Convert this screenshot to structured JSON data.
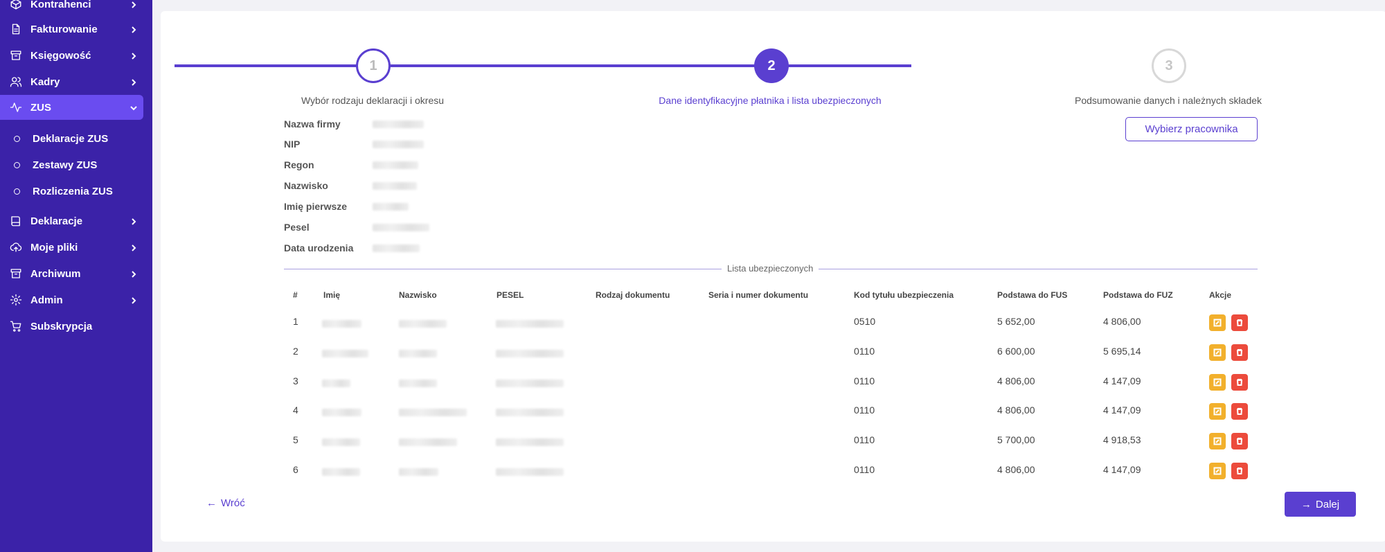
{
  "sidebar": {
    "items": [
      {
        "label": "Kontrahenci",
        "icon": "box-icon"
      },
      {
        "label": "Fakturowanie",
        "icon": "document-icon"
      },
      {
        "label": "Księgowość",
        "icon": "archive-icon"
      },
      {
        "label": "Kadry",
        "icon": "users-icon"
      },
      {
        "label": "ZUS",
        "icon": "activity-icon"
      },
      {
        "label": "Deklaracje",
        "icon": "book-icon"
      },
      {
        "label": "Moje pliki",
        "icon": "cloud-upload-icon"
      },
      {
        "label": "Archiwum",
        "icon": "archive-icon"
      },
      {
        "label": "Admin",
        "icon": "gear-icon"
      },
      {
        "label": "Subskrypcja",
        "icon": "cart-icon"
      }
    ],
    "zus_subitems": [
      "Deklaracje ZUS",
      "Zestawy ZUS",
      "Rozliczenia ZUS"
    ]
  },
  "steps": [
    {
      "number": "1",
      "label": "Wybór rodzaju deklaracji i okresu",
      "state": "done"
    },
    {
      "number": "2",
      "label": "Dane identyfikacyjne płatnika i lista ubezpieczonych",
      "state": "current"
    },
    {
      "number": "3",
      "label": "Podsumowanie danych i należnych składek",
      "state": "todo"
    }
  ],
  "payer": {
    "labels": [
      "Nazwa firmy",
      "NIP",
      "Regon",
      "Nazwisko",
      "Imię pierwsze",
      "Pesel",
      "Data urodzenia"
    ]
  },
  "pick_employee_label": "Wybierz pracownika",
  "insured_list_label": "Lista ubezpieczonych",
  "table": {
    "headers": [
      "#",
      "Imię",
      "Nazwisko",
      "PESEL",
      "Rodzaj dokumentu",
      "Seria i numer dokumentu",
      "Kod tytułu ubezpieczenia",
      "Podstawa do FUS",
      "Podstawa do FUZ",
      "Akcje"
    ],
    "rows": [
      {
        "no": "1",
        "code": "0510",
        "fus": "5 652,00",
        "fuz": "4 806,00"
      },
      {
        "no": "2",
        "code": "0110",
        "fus": "6 600,00",
        "fuz": "5 695,14"
      },
      {
        "no": "3",
        "code": "0110",
        "fus": "4 806,00",
        "fuz": "4 147,09"
      },
      {
        "no": "4",
        "code": "0110",
        "fus": "4 806,00",
        "fuz": "4 147,09"
      },
      {
        "no": "5",
        "code": "0110",
        "fus": "5 700,00",
        "fuz": "4 918,53"
      },
      {
        "no": "6",
        "code": "0110",
        "fus": "4 806,00",
        "fuz": "4 147,09"
      }
    ]
  },
  "back_label": "Wróć",
  "next_label": "Dalej",
  "colors": {
    "sidebar": "#3b22a8",
    "accent": "#5a3fd0",
    "active_nav": "#6a4cf0",
    "edit": "#f2b02c",
    "delete": "#ec4b3c"
  }
}
